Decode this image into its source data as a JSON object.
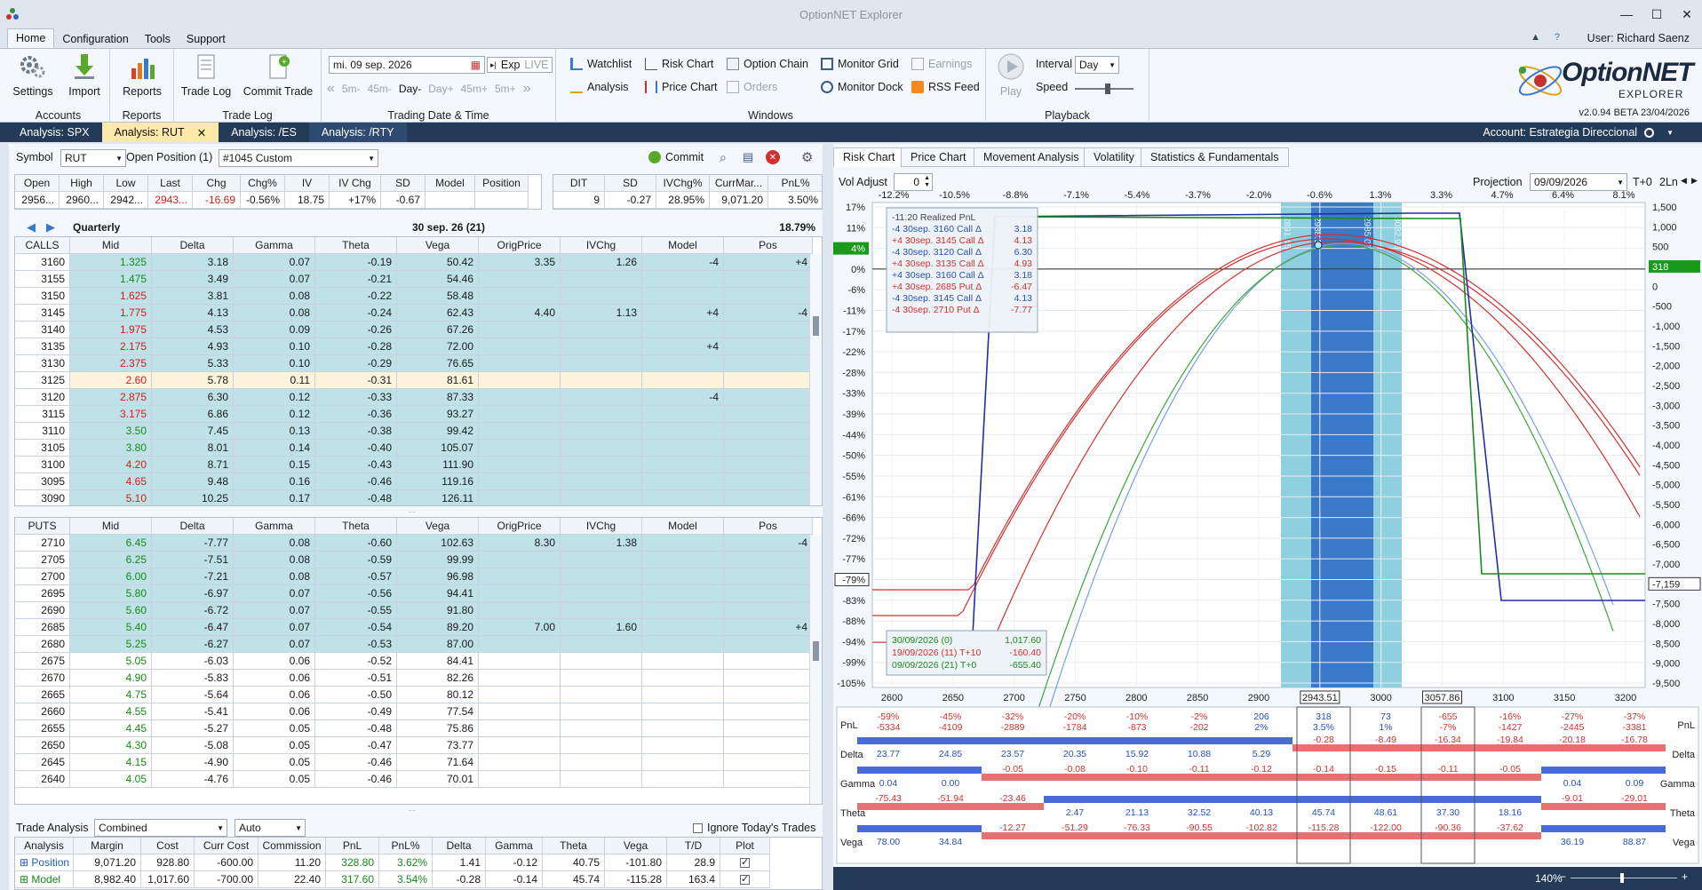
{
  "app": {
    "title": "OptionNET Explorer",
    "version": "v2.0.94 BETA 23/04/2026",
    "user": "User: Richard Saenz",
    "logo_main": "OptionNET",
    "logo_sub": "EXPLORER"
  },
  "menu": [
    "Home",
    "Configuration",
    "Tools",
    "Support"
  ],
  "ribbon": {
    "accounts": {
      "label": "Accounts",
      "settings": "Settings",
      "import": "Import"
    },
    "reports": {
      "label": "Reports",
      "reports": "Reports"
    },
    "tradelog": {
      "label": "Trade Log",
      "trade_log": "Trade Log",
      "commit_trade": "Commit Trade"
    },
    "tdt": {
      "label": "Trading Date & Time",
      "date": "mi. 09 sep. 2026",
      "exp": "Exp",
      "live": "LIVE",
      "steps": [
        "5m-",
        "45m-",
        "Day-",
        "Day+",
        "45m+",
        "5m+"
      ]
    },
    "windows": {
      "label": "Windows",
      "watchlist": "Watchlist",
      "risk_chart": "Risk Chart",
      "option_chain": "Option Chain",
      "monitor_grid": "Monitor Grid",
      "earnings": "Earnings",
      "analysis": "Analysis",
      "price_chart": "Price Chart",
      "orders": "Orders",
      "monitor_dock": "Monitor Dock",
      "rss_feed": "RSS Feed"
    },
    "playback": {
      "label": "Playback",
      "play": "Play",
      "interval_label": "Interval",
      "interval": "Day",
      "speed_label": "Speed"
    }
  },
  "doc_tabs": [
    "Analysis: SPX",
    "Analysis: RUT",
    "Analysis: /ES",
    "Analysis: /RTY"
  ],
  "account": "Account: Estrategia Direccional",
  "symbol": {
    "label": "Symbol",
    "value": "RUT",
    "open_pos_label": "Open Position (1)",
    "open_pos": "#1045 Custom",
    "commit": "Commit"
  },
  "quote": {
    "headers": [
      "Open",
      "High",
      "Low",
      "Last",
      "Chg",
      "Chg%",
      "IV",
      "IV Chg",
      "SD",
      "Model",
      "Position"
    ],
    "values": [
      "2956...",
      "2960...",
      "2942...",
      "2943...",
      "-16.69",
      "-0.56%",
      "18.75",
      "+17%",
      "-0.67",
      "",
      ""
    ]
  },
  "quote2": {
    "headers": [
      "DIT",
      "SD",
      "IVChg%",
      "CurrMar...",
      "PnL%"
    ],
    "values": [
      "9",
      "-0.27",
      "28.95%",
      "9,071.20",
      "3.50%"
    ]
  },
  "expiry": {
    "name": "Quarterly",
    "date": "30 sep. 26 (21)",
    "iv": "18.79%"
  },
  "chain_headers": [
    "Mid",
    "Delta",
    "Gamma",
    "Theta",
    "Vega",
    "OrigPrice",
    "IVChg",
    "Model",
    "Pos"
  ],
  "calls_label": "CALLS",
  "puts_label": "PUTS",
  "calls": [
    [
      "3160",
      "1.325",
      "3.18",
      "0.07",
      "-0.19",
      "50.42",
      "3.35",
      "1.26",
      "-4",
      "+4",
      "g",
      "t"
    ],
    [
      "3155",
      "1.475",
      "3.49",
      "0.07",
      "-0.21",
      "54.46",
      "",
      "",
      "",
      "",
      "g",
      "t"
    ],
    [
      "3150",
      "1.625",
      "3.81",
      "0.08",
      "-0.22",
      "58.48",
      "",
      "",
      "",
      "",
      "r",
      "t"
    ],
    [
      "3145",
      "1.775",
      "4.13",
      "0.08",
      "-0.24",
      "62.43",
      "4.40",
      "1.13",
      "+4",
      "-4",
      "r",
      "t"
    ],
    [
      "3140",
      "1.975",
      "4.53",
      "0.09",
      "-0.26",
      "67.26",
      "",
      "",
      "",
      "",
      "r",
      "t"
    ],
    [
      "3135",
      "2.175",
      "4.93",
      "0.10",
      "-0.28",
      "72.00",
      "",
      "",
      "+4",
      "",
      "r",
      "t"
    ],
    [
      "3130",
      "2.375",
      "5.33",
      "0.10",
      "-0.29",
      "76.65",
      "",
      "",
      "",
      "",
      "r",
      "t"
    ],
    [
      "3125",
      "2.60",
      "5.78",
      "0.11",
      "-0.31",
      "81.61",
      "",
      "",
      "",
      "",
      "r",
      "y"
    ],
    [
      "3120",
      "2.875",
      "6.30",
      "0.12",
      "-0.33",
      "87.33",
      "",
      "",
      "-4",
      "",
      "r",
      "t"
    ],
    [
      "3115",
      "3.175",
      "6.86",
      "0.12",
      "-0.36",
      "93.27",
      "",
      "",
      "",
      "",
      "r",
      "t"
    ],
    [
      "3110",
      "3.50",
      "7.45",
      "0.13",
      "-0.38",
      "99.42",
      "",
      "",
      "",
      "",
      "g",
      "t"
    ],
    [
      "3105",
      "3.80",
      "8.01",
      "0.14",
      "-0.40",
      "105.07",
      "",
      "",
      "",
      "",
      "g",
      "t"
    ],
    [
      "3100",
      "4.20",
      "8.71",
      "0.15",
      "-0.43",
      "111.90",
      "",
      "",
      "",
      "",
      "r",
      "t"
    ],
    [
      "3095",
      "4.65",
      "9.48",
      "0.16",
      "-0.46",
      "119.16",
      "",
      "",
      "",
      "",
      "r",
      "t"
    ],
    [
      "3090",
      "5.10",
      "10.25",
      "0.17",
      "-0.48",
      "126.11",
      "",
      "",
      "",
      "",
      "r",
      "t"
    ]
  ],
  "puts": [
    [
      "2710",
      "6.45",
      "-7.77",
      "0.08",
      "-0.60",
      "102.63",
      "8.30",
      "1.38",
      "",
      "-4",
      "g",
      "t"
    ],
    [
      "2705",
      "6.25",
      "-7.51",
      "0.08",
      "-0.59",
      "99.99",
      "",
      "",
      "",
      "",
      "g",
      "t"
    ],
    [
      "2700",
      "6.00",
      "-7.21",
      "0.08",
      "-0.57",
      "96.98",
      "",
      "",
      "",
      "",
      "g",
      "t"
    ],
    [
      "2695",
      "5.80",
      "-6.97",
      "0.07",
      "-0.56",
      "94.41",
      "",
      "",
      "",
      "",
      "g",
      "t"
    ],
    [
      "2690",
      "5.60",
      "-6.72",
      "0.07",
      "-0.55",
      "91.80",
      "",
      "",
      "",
      "",
      "g",
      "t"
    ],
    [
      "2685",
      "5.40",
      "-6.47",
      "0.07",
      "-0.54",
      "89.20",
      "7.00",
      "1.60",
      "",
      "+4",
      "g",
      "t"
    ],
    [
      "2680",
      "5.25",
      "-6.27",
      "0.07",
      "-0.53",
      "87.00",
      "",
      "",
      "",
      "",
      "g",
      "t"
    ],
    [
      "2675",
      "5.05",
      "-6.03",
      "0.06",
      "-0.52",
      "84.41",
      "",
      "",
      "",
      "",
      "g",
      "w"
    ],
    [
      "2670",
      "4.90",
      "-5.83",
      "0.06",
      "-0.51",
      "82.26",
      "",
      "",
      "",
      "",
      "g",
      "w"
    ],
    [
      "2665",
      "4.75",
      "-5.64",
      "0.06",
      "-0.50",
      "80.12",
      "",
      "",
      "",
      "",
      "g",
      "w"
    ],
    [
      "2660",
      "4.55",
      "-5.41",
      "0.06",
      "-0.49",
      "77.54",
      "",
      "",
      "",
      "",
      "g",
      "w"
    ],
    [
      "2655",
      "4.45",
      "-5.27",
      "0.05",
      "-0.48",
      "75.86",
      "",
      "",
      "",
      "",
      "g",
      "w"
    ],
    [
      "2650",
      "4.30",
      "-5.08",
      "0.05",
      "-0.47",
      "73.77",
      "",
      "",
      "",
      "",
      "g",
      "w"
    ],
    [
      "2645",
      "4.15",
      "-4.90",
      "0.05",
      "-0.46",
      "71.64",
      "",
      "",
      "",
      "",
      "g",
      "w"
    ],
    [
      "2640",
      "4.05",
      "-4.76",
      "0.05",
      "-0.46",
      "70.01",
      "",
      "",
      "",
      "",
      "g",
      "w"
    ]
  ],
  "trade_analysis": {
    "label": "Trade Analysis",
    "mode": "Combined",
    "scale": "Auto",
    "ignore": "Ignore Today's Trades",
    "headers": [
      "Analysis",
      "Margin",
      "Cost",
      "Curr Cost",
      "Commission",
      "PnL",
      "PnL%",
      "Delta",
      "Gamma",
      "Theta",
      "Vega",
      "T/D",
      "Plot"
    ],
    "rows": [
      [
        "Position",
        "9,071.20",
        "928.80",
        "-600.00",
        "11.20",
        "328.80",
        "3.62%",
        "1.41",
        "-0.12",
        "40.75",
        "-101.80",
        "28.9"
      ],
      [
        "Model",
        "8,982.40",
        "1,017.60",
        "-700.00",
        "22.40",
        "317.60",
        "3.54%",
        "-0.28",
        "-0.14",
        "45.74",
        "-115.28",
        "163.4"
      ]
    ]
  },
  "right_tabs": [
    "Risk Chart",
    "Price Chart",
    "Movement Analysis",
    "Volatility",
    "Statistics & Fundamentals"
  ],
  "risk": {
    "vol_adjust_label": "Vol Adjust",
    "vol_adjust": "0",
    "projection_label": "Projection",
    "projection": "09/09/2026",
    "tplus": "T+0",
    "ln": "2Ln",
    "top_pct": [
      "-12.2%",
      "-10.5%",
      "-8.8%",
      "-7.1%",
      "-5.4%",
      "-3.7%",
      "-2.0%",
      "-0.6%",
      "1.3%",
      "3.3%",
      "4.7%",
      "6.4%",
      "8.1%"
    ],
    "left_ticks": [
      "17%",
      "11%",
      "4%",
      "0%",
      "-6%",
      "-11%",
      "-17%",
      "-22%",
      "-28%",
      "-33%",
      "-39%",
      "-44%",
      "-50%",
      "-55%",
      "-61%",
      "-66%",
      "-72%",
      "-77%",
      "-79%",
      "-83%",
      "-88%",
      "-94%",
      "-99%",
      "-105%"
    ],
    "right_ticks": [
      "1,500",
      "1,000",
      "500",
      "318",
      "0",
      "-500",
      "-1,000",
      "-1,500",
      "-2,000",
      "-2,500",
      "-3,000",
      "-3,500",
      "-4,000",
      "-4,500",
      "-5,000",
      "-5,500",
      "-6,000",
      "-6,500",
      "-7,000",
      "-7,159",
      "-7,500",
      "-8,000",
      "-8,500",
      "-9,000",
      "-9,500"
    ],
    "x_ticks": [
      "2600",
      "2650",
      "2700",
      "2750",
      "2800",
      "2850",
      "2900",
      "2943.51",
      "3000",
      "3057.86",
      "3100",
      "3150",
      "3200"
    ],
    "band_labels": [
      "2891.45",
      "2938.33",
      "2985.07",
      "3032.96"
    ],
    "legend": [
      [
        "-11.20 Realized PnL",
        ""
      ],
      [
        "-4 30sep. 3160 Call Δ",
        "3.18"
      ],
      [
        "+4 30sep. 3145 Call Δ",
        "4.13"
      ],
      [
        "-4 30sep. 3120 Call Δ",
        "6.30"
      ],
      [
        "+4 30sep. 3135 Call Δ",
        "4.93"
      ],
      [
        "+4 30sep. 3160 Call Δ",
        "3.18"
      ],
      [
        "+4 30sep. 2685 Put Δ",
        "-6.47"
      ],
      [
        "-4 30sep. 3145 Call Δ",
        "4.13"
      ],
      [
        "-4 30sep. 2710 Put Δ",
        "-7.77"
      ]
    ],
    "legend2": [
      [
        "30/09/2026 (0)",
        "1,017.60"
      ],
      [
        "19/09/2026 (11) T+10",
        "-160.40"
      ],
      [
        "09/09/2026 (21) T+0",
        "-655.40"
      ]
    ]
  },
  "greeks": {
    "labels": [
      "PnL",
      "Delta",
      "Gamma",
      "Theta",
      "Vega"
    ],
    "pnl": [
      [
        "-59%",
        "-5334"
      ],
      [
        "-45%",
        "-4109"
      ],
      [
        "-32%",
        "-2889"
      ],
      [
        "-20%",
        "-1784"
      ],
      [
        "-10%",
        "-873"
      ],
      [
        "-2%",
        "-202"
      ],
      [
        "206",
        "2%"
      ],
      [
        "318",
        "3.5%"
      ],
      [
        "73",
        "1%"
      ],
      [
        "-655",
        "-7%"
      ],
      [
        "-16%",
        "-1427"
      ],
      [
        "-27%",
        "-2445"
      ],
      [
        "-37%",
        "-3381"
      ]
    ],
    "delta": [
      "23.77",
      "24.85",
      "23.57",
      "20.35",
      "15.92",
      "10.88",
      "5.29",
      "-0.28",
      "-8.49",
      "-16.34",
      "-19.84",
      "-20.18",
      "-16.78"
    ],
    "gamma": [
      "0.04",
      "0.00",
      "-0.05",
      "-0.08",
      "-0.10",
      "-0.11",
      "-0.12",
      "-0.14",
      "-0.15",
      "-0.11",
      "-0.05",
      "0.04",
      "0.09"
    ],
    "theta": [
      "-75.43",
      "-51.94",
      "-23.46",
      "2.47",
      "21.13",
      "32.52",
      "40.13",
      "45.74",
      "48.61",
      "37.30",
      "18.16",
      "-9.01",
      "-29.01"
    ],
    "vega": [
      "78.00",
      "34.84",
      "-12.27",
      "-51.29",
      "-76.33",
      "-90.55",
      "-102.82",
      "-115.28",
      "-122.00",
      "-90.36",
      "-37.62",
      "36.19",
      "88.87"
    ]
  },
  "status": {
    "zoom": "140%"
  }
}
